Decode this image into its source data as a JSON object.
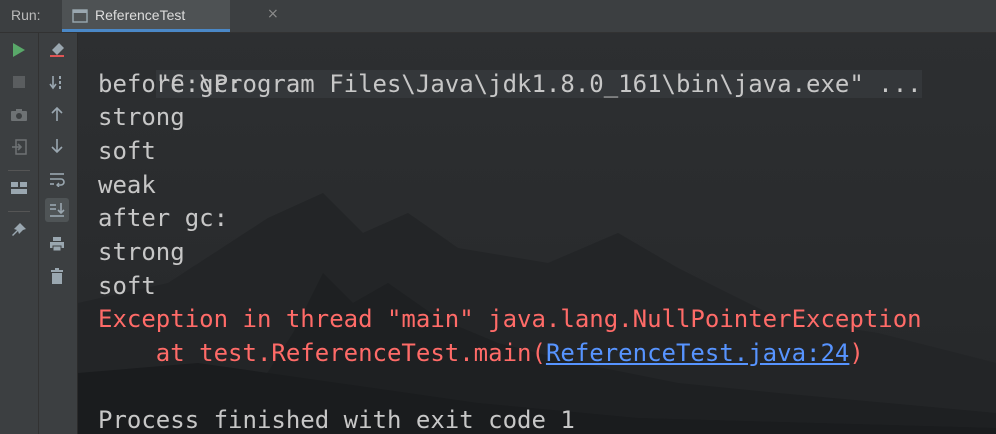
{
  "run_label": "Run:",
  "tab": {
    "title": "ReferenceTest",
    "close": "×"
  },
  "toolbar_left": [
    "run-icon",
    "stop-icon",
    "camera-icon",
    "login-icon",
    "layout-icon",
    "pin-icon"
  ],
  "toolbar_right": [
    "clear-icon",
    "sort-icon",
    "arrow-up-icon",
    "arrow-down-icon",
    "soft-wrap-icon",
    "scroll-to-end-icon",
    "print-icon",
    "trash-icon"
  ],
  "console": {
    "command": "\"C:\\Program Files\\Java\\jdk1.8.0_161\\bin\\java.exe\" ...",
    "lines": [
      "before gc:",
      "strong",
      "soft",
      "weak",
      "after gc:",
      "strong",
      "soft"
    ],
    "exception": "Exception in thread \"main\" java.lang.NullPointerException",
    "stack_prefix": "    at test.ReferenceTest.main(",
    "stack_link": "ReferenceTest.java:24",
    "stack_suffix": ")",
    "blank": "",
    "exit": "Process finished with exit code 1"
  },
  "colors": {
    "error": "#ff6b68",
    "link": "#5794ff",
    "run_green": "#59a869",
    "accent": "#4a88c7"
  }
}
